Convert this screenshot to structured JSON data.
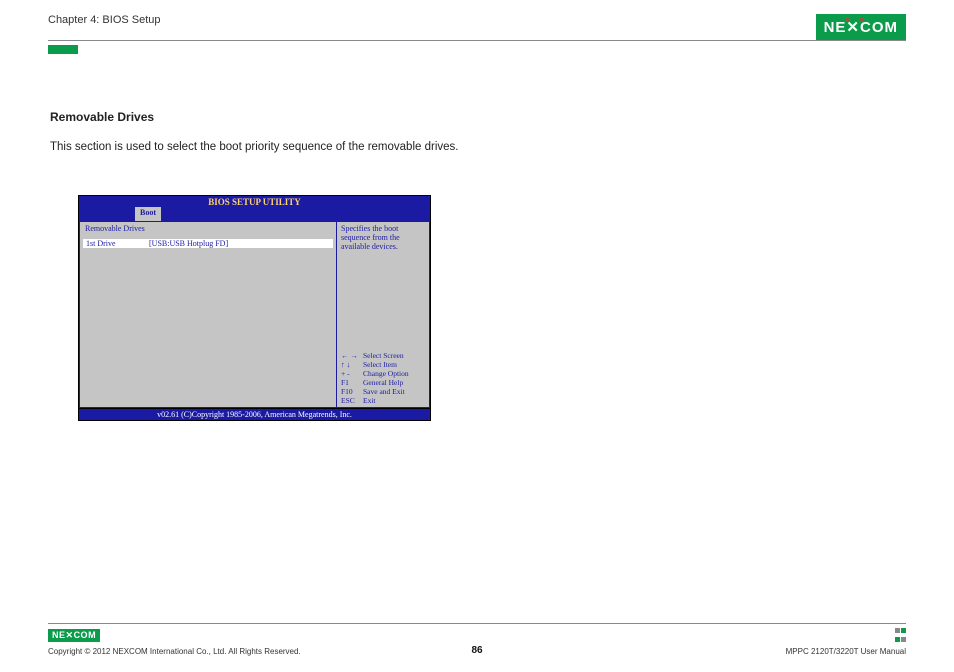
{
  "header": {
    "chapter_title": "Chapter 4: BIOS Setup",
    "logo_text": "NE COM",
    "logo_x": "X"
  },
  "section": {
    "heading": "Removable Drives",
    "description": "This section is used to select the boot priority sequence of the removable drives."
  },
  "bios": {
    "title": "BIOS SETUP UTILITY",
    "active_tab": "Boot",
    "left_panel_title": "Removable Drives",
    "selected_item_label": "1st Drive",
    "selected_item_value": "[USB:USB Hotplug FD]",
    "help_text": "Specifies the boot sequence from the available devices.",
    "keys": [
      {
        "k": "← →",
        "a": "Select Screen"
      },
      {
        "k": "↑ ↓",
        "a": "Select Item"
      },
      {
        "k": "+ -",
        "a": "Change Option"
      },
      {
        "k": "F1",
        "a": "General Help"
      },
      {
        "k": "F10",
        "a": "Save and Exit"
      },
      {
        "k": "ESC",
        "a": "Exit"
      }
    ],
    "footer": "v02.61 (C)Copyright 1985-2006, American Megatrends, Inc."
  },
  "footer": {
    "logo_text": "NE COM",
    "logo_x": "X",
    "copyright": "Copyright © 2012 NEXCOM International Co., Ltd. All Rights Reserved.",
    "page_number": "86",
    "doc_title": "MPPC 2120T/3220T User Manual"
  }
}
